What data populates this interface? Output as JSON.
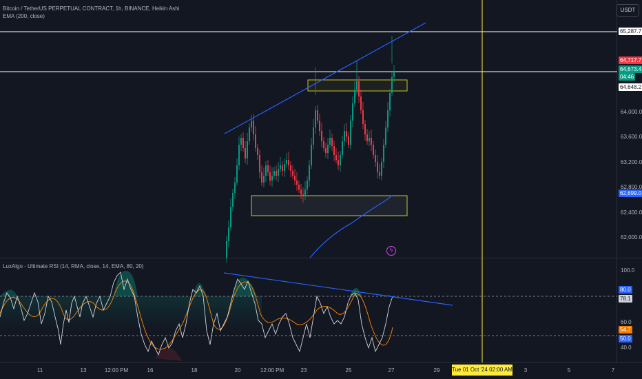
{
  "header": {
    "symbol_title": "Bitcoin / TetherUS PERPETUAL CONTRACT, 1h, BINANCE, Heikin Ashi",
    "ema_legend": "EMA (200, close)",
    "currency_button": "USDT"
  },
  "price_axis": {
    "ticks": [
      {
        "value": 64000,
        "label": "64,000.0"
      },
      {
        "value": 63600,
        "label": "63,600.0"
      },
      {
        "value": 63200,
        "label": "63,200.0"
      },
      {
        "value": 62800,
        "label": "62,800.0"
      },
      {
        "value": 62400,
        "label": "62,400.0"
      },
      {
        "value": 62000,
        "label": "62,000.0"
      }
    ],
    "tags": [
      {
        "value": 65287.7,
        "label": "65,287.7",
        "kind": "hline",
        "bg": "#ffffff",
        "fg": "#131722"
      },
      {
        "value": 64717.7,
        "label": "64,717.7",
        "kind": "high",
        "bg": "#f23645",
        "fg": "#ffffff"
      },
      {
        "value": 64673.4,
        "label": "64,673.4",
        "kind": "last",
        "bg": "#089981",
        "fg": "#ffffff"
      },
      {
        "value": 64600,
        "label": "04:46",
        "kind": "countdown",
        "bg": "#089981",
        "fg": "#ffffff"
      },
      {
        "value": 64648.2,
        "label": "64,648.2",
        "kind": "hline",
        "bg": "#ffffff",
        "fg": "#131722"
      },
      {
        "value": 62699.0,
        "label": "62,699.0",
        "kind": "ema",
        "bg": "#2962ff",
        "fg": "#ffffff"
      }
    ]
  },
  "rsi": {
    "legend": "LuxAlgo - Ultimate RSI (14, RMA, close, 14, EMA, 80, 20)",
    "ticks": [
      {
        "value": 100,
        "label": "100.0"
      },
      {
        "value": 60,
        "label": "60.0"
      },
      {
        "value": 40,
        "label": "40.0"
      }
    ],
    "tags": [
      {
        "value": 80,
        "label": "80.0",
        "bg": "#2962ff",
        "fg": "#ffffff"
      },
      {
        "value": 78.1,
        "label": "78.1",
        "bg": "#d1d4dc",
        "fg": "#131722"
      },
      {
        "value": 54.7,
        "label": "54.7",
        "bg": "#f57c00",
        "fg": "#ffffff"
      },
      {
        "value": 50,
        "label": "50.0",
        "bg": "#2962ff",
        "fg": "#ffffff"
      }
    ],
    "levels": [
      80,
      50
    ]
  },
  "time_axis": {
    "labels": [
      "11",
      "13",
      "12:00 PM",
      "16",
      "18",
      "20",
      "12:00 PM",
      "23",
      "25",
      "27",
      "29",
      "3",
      "5",
      "7"
    ],
    "crosshair_label": "Tue 01 Oct '24   02:00 AM"
  },
  "colors": {
    "background": "#131722",
    "up": "#089981",
    "down": "#f23645",
    "ema": "#2962ff",
    "trendline": "#2962ff",
    "zone": "#c8c81e",
    "crosshair": "#ffeb3b",
    "rsi_line": "#d1d4dc",
    "rsi_signal": "#f57c00"
  },
  "icons": {
    "bolt": "lightning-bolt-icon"
  }
}
